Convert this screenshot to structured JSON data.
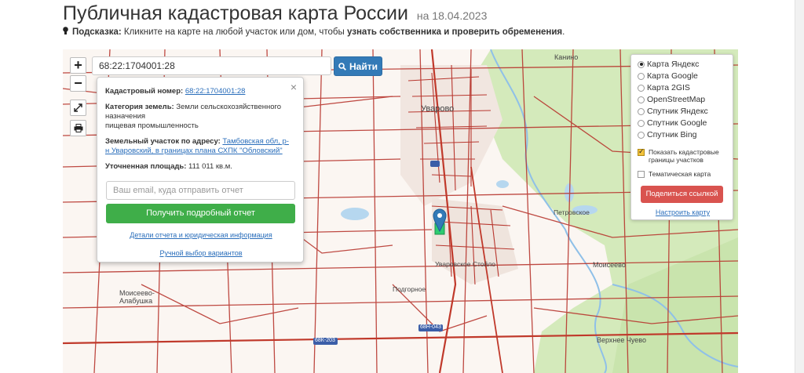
{
  "header": {
    "title": "Публичная кадастровая карта России",
    "date": "на 18.04.2023"
  },
  "hint": {
    "label": "Подсказка:",
    "text": " Кликните на карте на любой участок или дом, чтобы ",
    "bold": "узнать собственника и проверить обременения",
    "end": "."
  },
  "search": {
    "value": "68:22:1704001:28",
    "button_label": "Найти"
  },
  "map_controls": {
    "zoom_in": "+",
    "zoom_out": "−"
  },
  "popup": {
    "close": "×",
    "cadastral_label": "Кадастровый номер:",
    "cadastral_value": "68:22:1704001:28",
    "category_label": "Категория земель:",
    "category_value_1": "Земли сельскохозяйственного назначения",
    "category_value_2": "пищевая промышленность",
    "address_label": "Земельный участок по адресу:",
    "address_value": "Тамбовская обл, р-н Уваровский, в границах плана СХПК \"Обловский\"",
    "area_label": "Уточненная площадь:",
    "area_value": "111 011 кв.м.",
    "email_placeholder": "Ваш email, куда отправить отчет",
    "report_button": "Получить подробный отчет",
    "details_link": "Детали отчета и юридическая информация",
    "manual_link": "Ручной выбор вариантов"
  },
  "layers": {
    "options": [
      {
        "label": "Карта Яндекс",
        "selected": true
      },
      {
        "label": "Карта Google",
        "selected": false
      },
      {
        "label": "Карта 2GIS",
        "selected": false
      },
      {
        "label": "OpenStreetMap",
        "selected": false
      },
      {
        "label": "Спутник Яндекс",
        "selected": false
      },
      {
        "label": "Спутник Google",
        "selected": false
      },
      {
        "label": "Спутник Bing",
        "selected": false
      }
    ],
    "show_borders": "Показать кадастровые границы участков",
    "show_borders_checked": true,
    "thematic": "Тематическая карта",
    "thematic_checked": false,
    "share_button": "Поделиться ссылкой",
    "configure_link": "Настроить карту"
  },
  "map_labels": {
    "kanino": "Канино",
    "uvarovo": "Уварово",
    "petrovskoe": "Петровское",
    "moiseevo": "Моисеево",
    "moiseevo_alabushka": "Моисеево-Алабушка",
    "podgornoe": "Подгорное",
    "verkhnee_chuevo": "Верхнее Чуево",
    "uvarov_stoilo": "Уваровское Стойло",
    "road_68n043": "68Н-043",
    "road_68k": "68К-203"
  },
  "colors": {
    "accent_blue": "#337ab7",
    "report_green": "#3fae49",
    "share_red": "#d9534f",
    "cadastral_border": "#b8372f",
    "forest_green": "#cfe8b4"
  }
}
